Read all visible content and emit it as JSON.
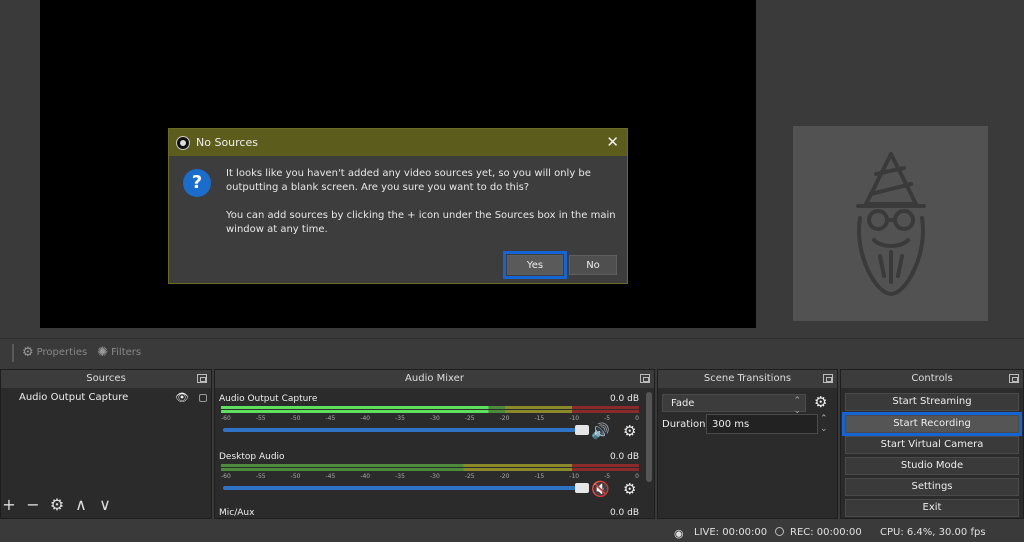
{
  "dialog": {
    "title": "No Sources",
    "close": "✕",
    "question_icon": "?",
    "message_line1": "It looks like you haven't added any video sources yet, so you will only be outputting a blank screen. Are you sure you want to do this?",
    "message_line2": "You can add sources by clicking the + icon under the Sources box in the main window at any time.",
    "yes_label": "Yes",
    "no_label": "No"
  },
  "toolbar": {
    "properties_label": "Properties",
    "filters_label": "Filters"
  },
  "sources": {
    "title": "Sources",
    "items": [
      {
        "label": "Audio Output Capture"
      }
    ],
    "tools": {
      "add": "+",
      "remove": "−",
      "settings": "⚙",
      "up": "∧",
      "down": "∨"
    }
  },
  "mixer": {
    "title": "Audio Mixer",
    "ticks": [
      "-60",
      "-55",
      "-50",
      "-45",
      "-40",
      "-35",
      "-30",
      "-25",
      "-20",
      "-15",
      "-10",
      "-5",
      "0"
    ],
    "channels": [
      {
        "name": "Audio Output Capture",
        "db": "0.0 dB",
        "muted": false
      },
      {
        "name": "Desktop Audio",
        "db": "0.0 dB",
        "muted": true
      },
      {
        "name": "Mic/Aux",
        "db": "0.0 dB",
        "muted": false
      }
    ]
  },
  "transitions": {
    "title": "Scene Transitions",
    "selected": "Fade",
    "duration_label": "Duration",
    "duration_value": "300 ms"
  },
  "controls": {
    "title": "Controls",
    "buttons": [
      "Start Streaming",
      "Start Recording",
      "Start Virtual Camera",
      "Studio Mode",
      "Settings",
      "Exit"
    ]
  },
  "status": {
    "live": "LIVE: 00:00:00",
    "rec": "REC: 00:00:00",
    "cpu": "CPU: 6.4%, 30.00 fps"
  },
  "colors": {
    "accent": "#1464d6",
    "dialog_title": "#5c5c1c",
    "muted": "#e02020"
  }
}
